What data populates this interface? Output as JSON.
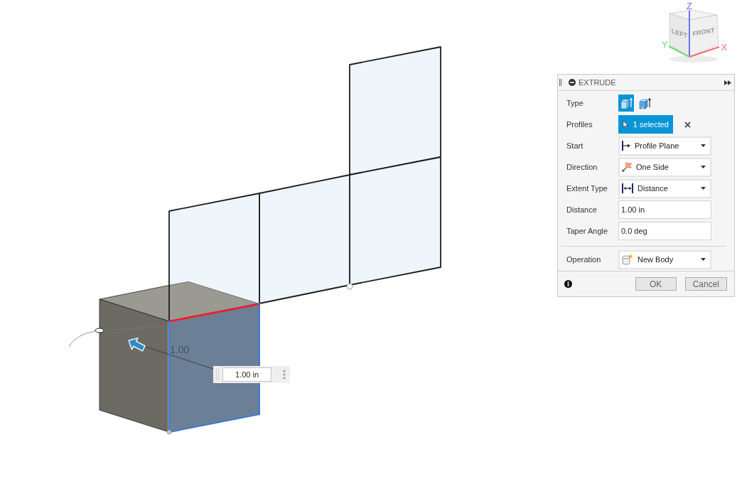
{
  "viewport": {
    "dimension_label": "1.00",
    "dimension_input": {
      "value": "1.00 in"
    }
  },
  "view_cube": {
    "faces": [
      "LEFT",
      "FRONT"
    ],
    "axes": [
      {
        "label": "Z",
        "color": "#6f6ff2"
      },
      {
        "label": "X",
        "color": "#f26f6f"
      },
      {
        "label": "Y",
        "color": "#6fd96f"
      }
    ]
  },
  "panel": {
    "title": "EXTRUDE",
    "groups": [
      {
        "rows": [
          {
            "kind": "toggle",
            "label": "Type",
            "options": [
              {
                "selected": true
              },
              {
                "selected": false
              }
            ]
          },
          {
            "kind": "selection",
            "label": "Profiles",
            "value": "1 selected"
          },
          {
            "kind": "dropdown",
            "label": "Start",
            "value": "Profile Plane"
          },
          {
            "kind": "dropdown",
            "label": "Direction",
            "value": "One Side"
          },
          {
            "kind": "dropdown",
            "label": "Extent Type",
            "value": "Distance"
          },
          {
            "kind": "input",
            "label": "Distance",
            "value": "1.00 in"
          },
          {
            "kind": "input",
            "label": "Taper Angle",
            "value": "0.0 deg"
          }
        ]
      },
      {
        "rows": [
          {
            "kind": "dropdown",
            "label": "Operation",
            "value": "New Body"
          }
        ]
      }
    ],
    "buttons": [
      "OK",
      "Cancel"
    ]
  }
}
